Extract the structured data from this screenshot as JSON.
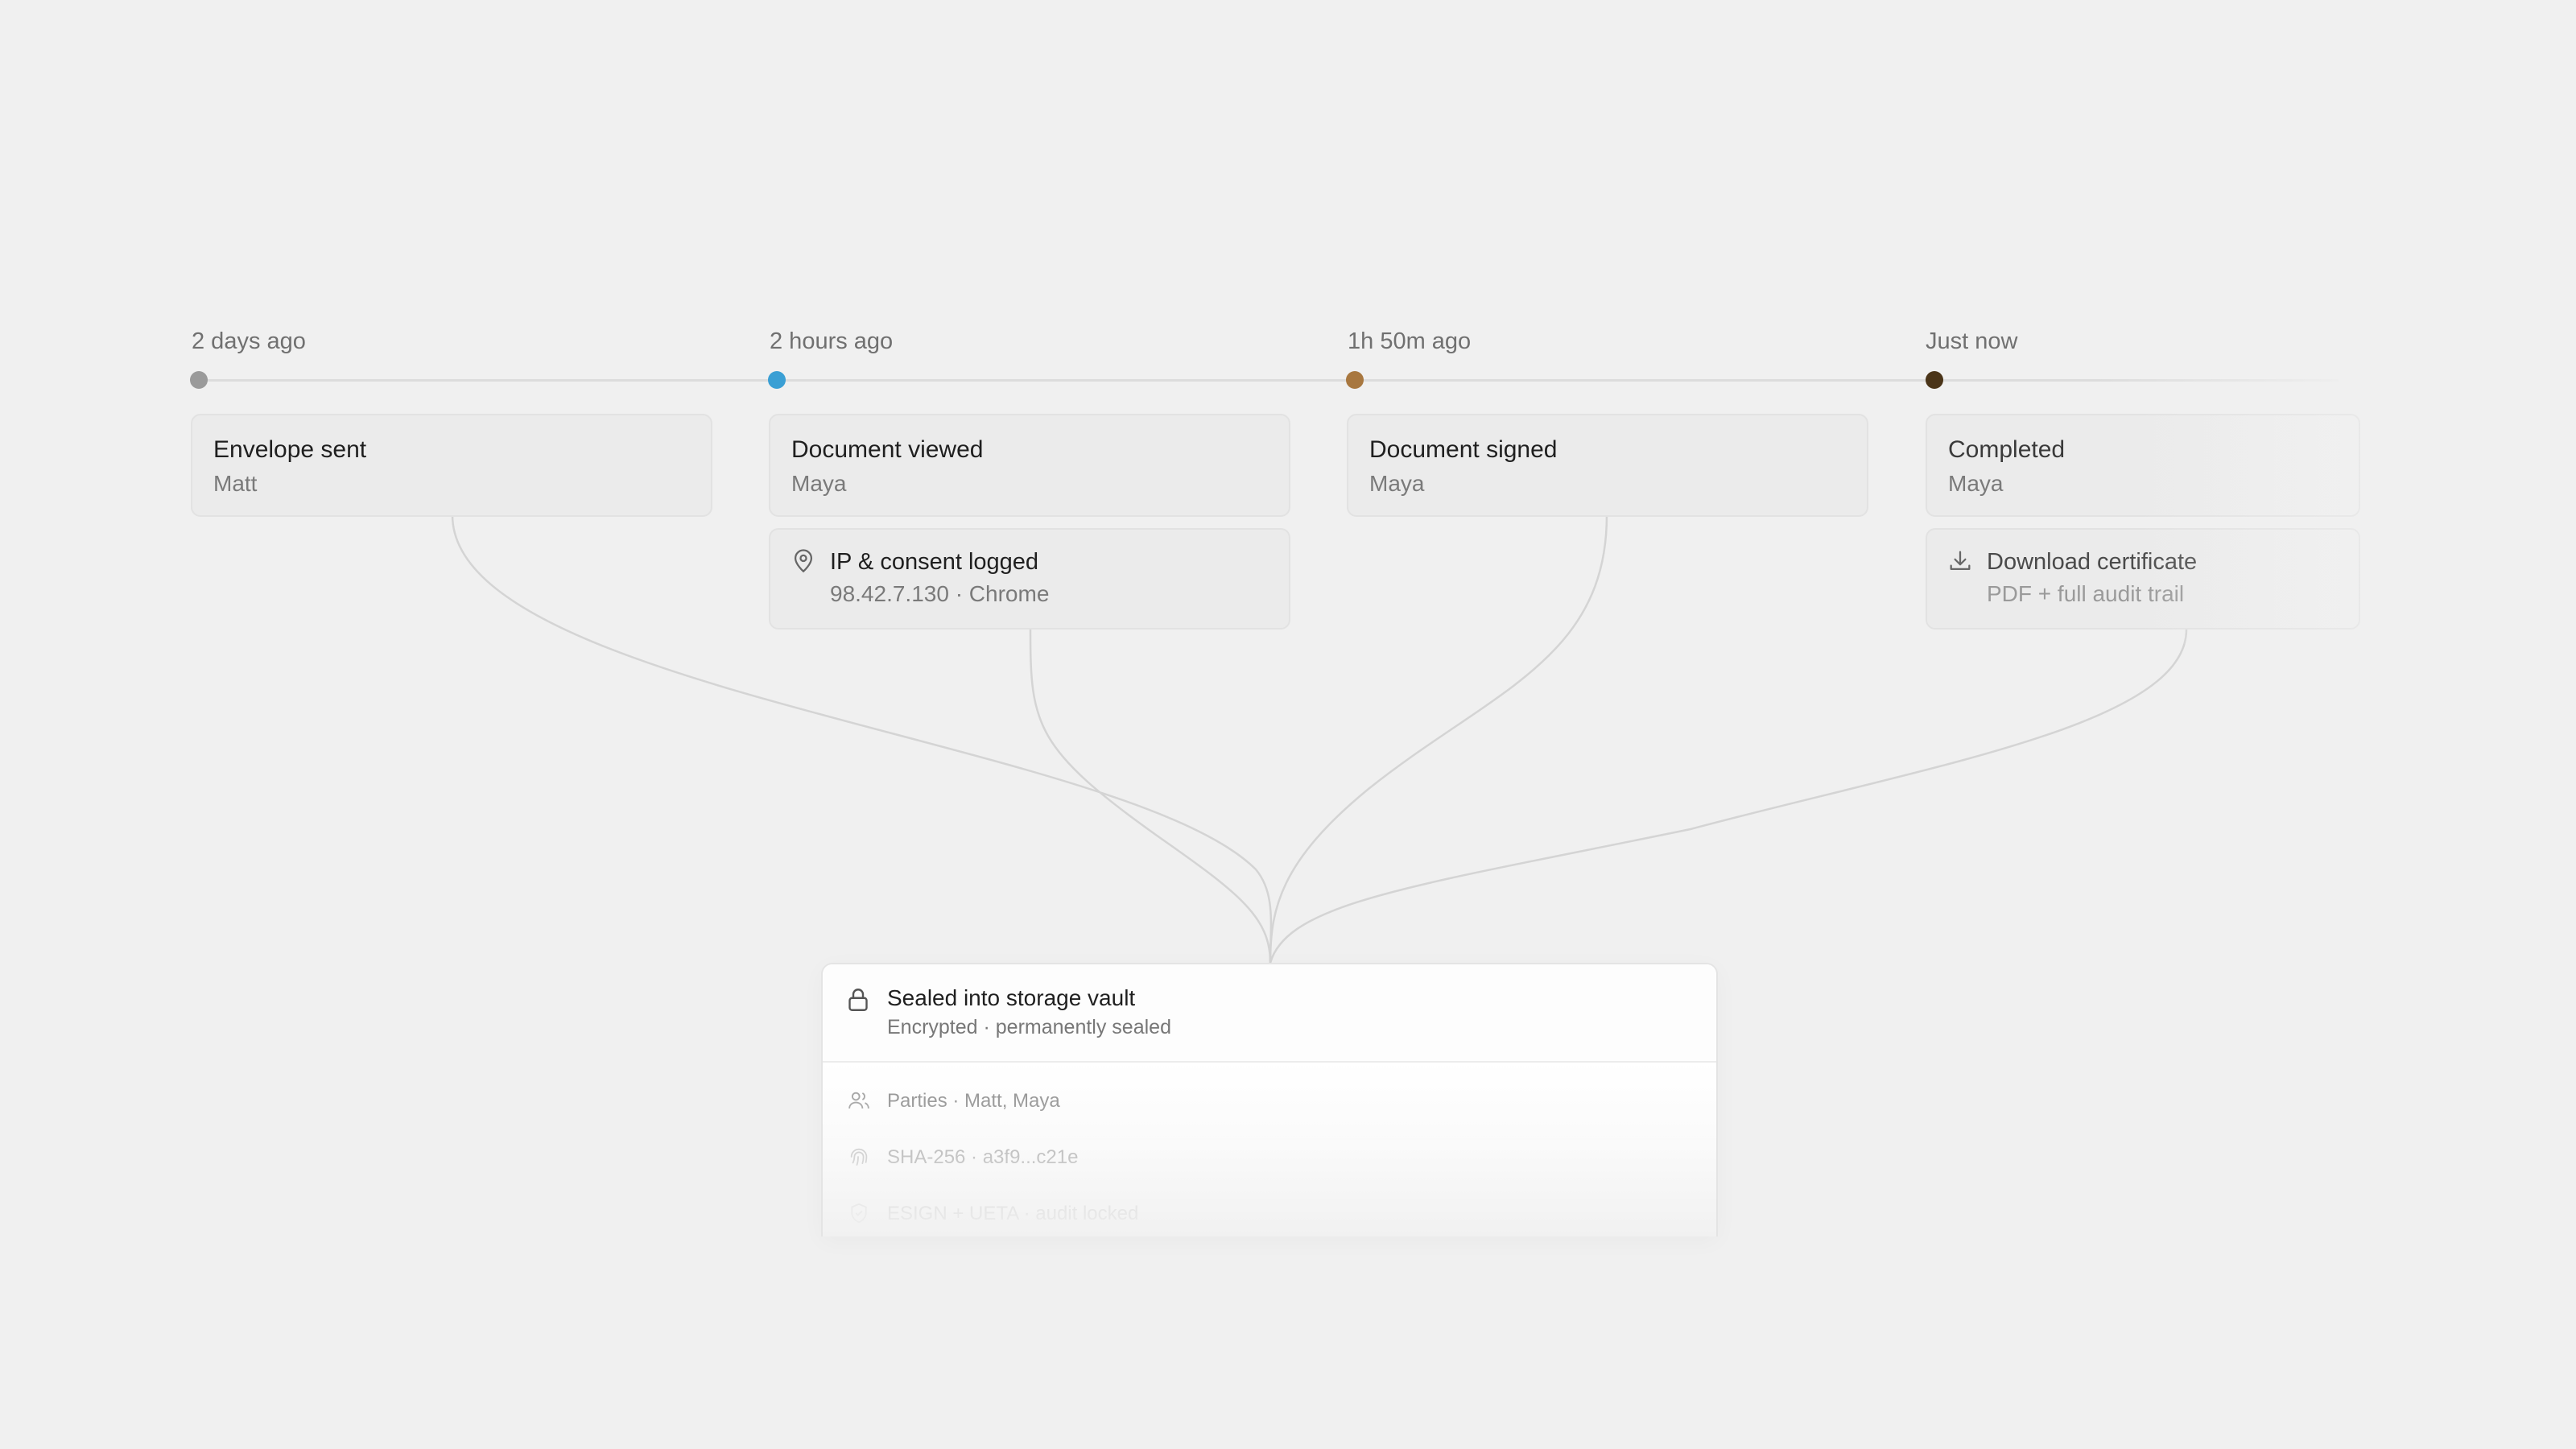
{
  "timeline": {
    "events": [
      {
        "time": "2 days ago",
        "title": "Envelope sent",
        "person": "Matt",
        "dot_color": "#9a9a9a"
      },
      {
        "time": "2 hours ago",
        "title": "Document viewed",
        "person": "Maya",
        "dot_color": "#3a9fd4",
        "detail": {
          "icon": "location-pin-icon",
          "title": "IP & consent logged",
          "sub": "98.42.7.130 · Chrome"
        }
      },
      {
        "time": "1h 50m ago",
        "title": "Document signed",
        "person": "Maya",
        "dot_color": "#a8773f"
      },
      {
        "time": "Just now",
        "title": "Completed",
        "person": "Maya",
        "dot_color": "#4a3418",
        "detail": {
          "icon": "download-icon",
          "title": "Download certificate",
          "sub": "PDF + full audit trail"
        }
      }
    ]
  },
  "vault": {
    "icon": "lock-icon",
    "title": "Sealed into storage vault",
    "subtitle": "Encrypted · permanently sealed",
    "rows": [
      {
        "icon": "users-icon",
        "text": "Parties · Matt, Maya"
      },
      {
        "icon": "fingerprint-icon",
        "text": "SHA-256 · a3f9...c21e"
      },
      {
        "icon": "shield-check-icon",
        "text": "ESIGN + UETA · audit locked"
      }
    ]
  }
}
